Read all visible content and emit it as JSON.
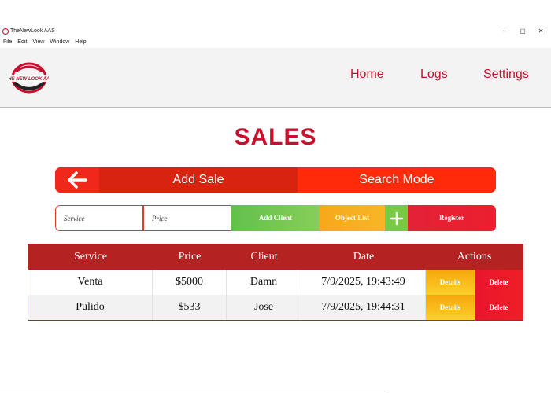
{
  "window": {
    "title": "TheNewLook AAS",
    "controls": [
      "–",
      "▢",
      "✕"
    ]
  },
  "menu": [
    "File",
    "Edit",
    "View",
    "Window",
    "Help"
  ],
  "header": {
    "logo_text": "THE NEW LOOK AAS",
    "nav": [
      "Home",
      "Logs",
      "Settings"
    ]
  },
  "page": {
    "title": "SALES"
  },
  "modes": {
    "add_sale": "Add Sale",
    "search_mode": "Search Mode"
  },
  "form": {
    "service_placeholder": "Service",
    "price_placeholder": "Price",
    "add_client": "Add Client",
    "object_list": "Object List",
    "register": "Register"
  },
  "table": {
    "headers": [
      "Service",
      "Price",
      "Client",
      "Date",
      "Actions"
    ],
    "rows": [
      {
        "service": "Venta",
        "price": "$5000",
        "client": "Damn",
        "date": "7/9/2025, 19:43:49",
        "details": "Details",
        "delete": "Delete"
      },
      {
        "service": "Pulido",
        "price": "$533",
        "client": "Jose",
        "date": "7/9/2025, 19:44:31",
        "details": "Details",
        "delete": "Delete"
      }
    ]
  },
  "colors": {
    "brand_red": "#c8102e",
    "table_header": "#b52222",
    "add_client_green": "#63c04c",
    "object_list_orange": "#f7a81b"
  }
}
